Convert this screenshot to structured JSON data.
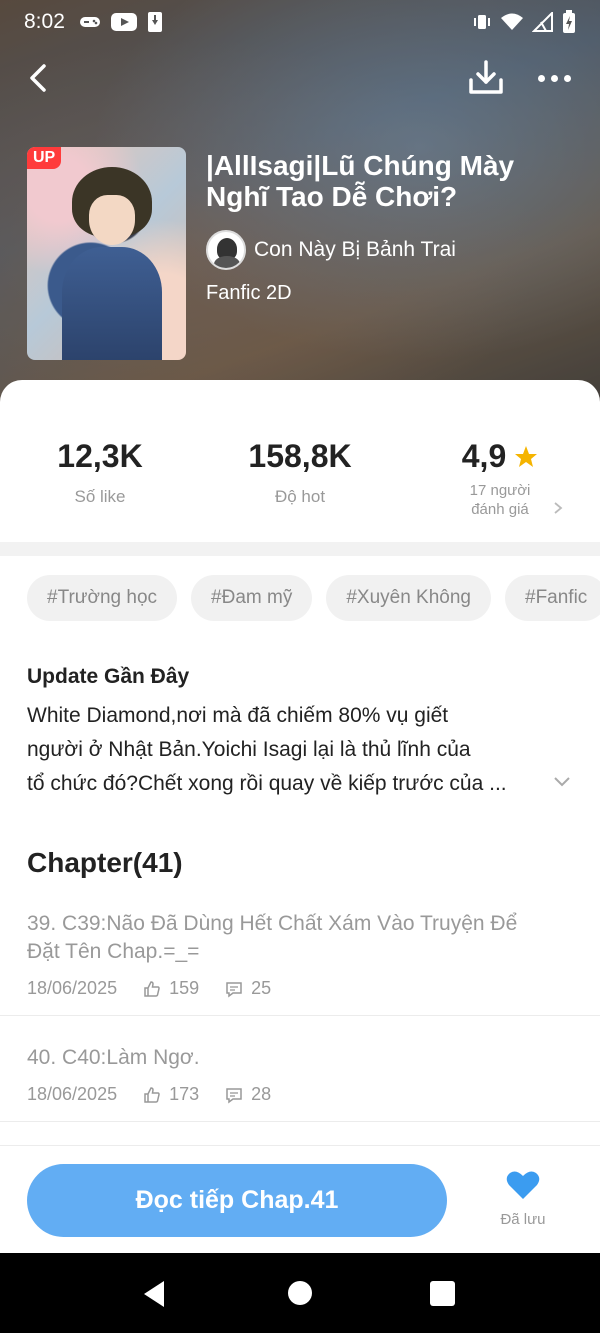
{
  "status": {
    "time": "8:02"
  },
  "book": {
    "badge": "UP",
    "title": "|AllIsagi|Lũ Chúng Mày Nghĩ Tao Dễ Chơi?",
    "author": "Con Này Bị Bảnh Trai",
    "genre": "Fanfic 2D"
  },
  "stats": {
    "likes": {
      "value": "12,3K",
      "label": "Số like"
    },
    "hot": {
      "value": "158,8K",
      "label": "Độ hot"
    },
    "rating": {
      "value": "4,9",
      "label_line1": "17 người",
      "label_line2": "đánh giá"
    }
  },
  "tags": [
    "#Trường học",
    "#Đam mỹ",
    "#Xuyên Không",
    "#Fanfic"
  ],
  "update": {
    "title": "Update Gần Đây",
    "lines": [
      "White Diamond,nơi mà đã chiếm 80% vụ giết",
      "người ở Nhật Bản.Yoichi Isagi lại là thủ lĩnh của",
      "tổ chức đó?Chết xong rồi quay về kiếp trước của ..."
    ]
  },
  "chapters": {
    "header": "Chapter(41)",
    "items": [
      {
        "title": "39. C39:Não Đã Dùng Hết Chất Xám Vào Truyện Để Đặt Tên Chap.=_=",
        "date": "18/06/2025",
        "likes": "159",
        "comments": "25"
      },
      {
        "title": "40. C40:Làm Ngơ.",
        "date": "18/06/2025",
        "likes": "173",
        "comments": "28"
      }
    ]
  },
  "actions": {
    "read_label": "Đọc tiếp Chap.41",
    "saved_label": "Đã lưu"
  },
  "colors": {
    "accent": "#62adf3",
    "star": "#f5b400",
    "badge": "#ff3b3b"
  }
}
